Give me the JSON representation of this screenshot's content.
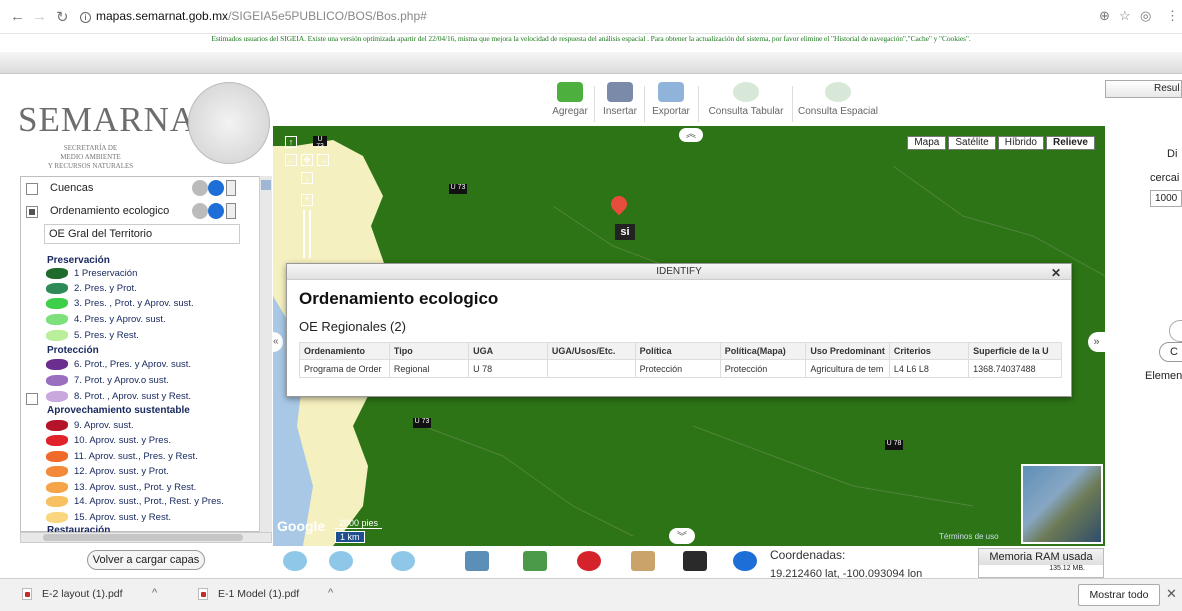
{
  "browser": {
    "url_host": "mapas.semarnat.gob.mx",
    "url_path": "/SIGEIA5e5PUBLICO/BOS/Bos.php#",
    "notice": "Estimados usuarios del SIGEIA. Existe una versión optimizada apartir del 22/04/16, misma que mejora la velocidad de respuesta del análisis espacial . Para obtener la actualización del sistema, por favor elimine el \"Historial de navegación\",\"Cache\" y \"Cookies\"."
  },
  "logo": {
    "name": "SEMARNAT",
    "subtitle_1": "SECRETARÍA DE",
    "subtitle_2": "MEDIO AMBIENTE",
    "subtitle_3": "Y RECURSOS NATURALES"
  },
  "toolbar": {
    "agregar": "Agregar",
    "insertar": "Insertar",
    "exportar": "Exportar",
    "consulta_tabular": "Consulta Tabular",
    "consulta_espacial": "Consulta Espacial"
  },
  "right_panel": {
    "tab": "Resul",
    "line1": "Di",
    "line2": "cercai",
    "input_value": "1000",
    "button": "C",
    "label": "Element"
  },
  "layers": {
    "items": [
      {
        "label": "Cuencas",
        "checked": false
      },
      {
        "label": "Ordenamiento ecologico",
        "checked": true
      }
    ],
    "sub_select": "OE Gral del Territorio",
    "legend": {
      "preservacion": "Preservación",
      "proteccion": "Protección",
      "aprovechamiento": "Aprovechamiento sustentable",
      "restauracion": "Restauración",
      "entries": [
        {
          "label": "1 Preservación",
          "color": "#1e6b2c"
        },
        {
          "label": "2. Pres. y Prot.",
          "color": "#2e8b57"
        },
        {
          "label": "3. Pres. , Prot. y Aprov. sust.",
          "color": "#3ecf4a"
        },
        {
          "label": "4. Pres. y Aprov. sust.",
          "color": "#7ee07a"
        },
        {
          "label": "5. Pres. y Rest.",
          "color": "#b9ee9a"
        },
        {
          "label": "6. Prot., Pres. y Aprov. sust.",
          "color": "#6b2d8f"
        },
        {
          "label": "7. Prot. y Aprov.o sust.",
          "color": "#9a6fbf"
        },
        {
          "label": "8. Prot. , Aprov. sust y Rest.",
          "color": "#c8a8df"
        },
        {
          "label": "9.  Aprov. sust.",
          "color": "#b5132a"
        },
        {
          "label": "10. Aprov. sust. y Pres.",
          "color": "#e0232b"
        },
        {
          "label": "11. Aprov. sust., Pres. y Rest.",
          "color": "#f06a2a"
        },
        {
          "label": "12. Aprov. sust. y Prot.",
          "color": "#f28a3a"
        },
        {
          "label": "13. Aprov. sust., Prot. y Rest.",
          "color": "#f5a44a"
        },
        {
          "label": "14. Aprov. sust., Prot., Rest. y Pres.",
          "color": "#f8c060"
        },
        {
          "label": "15. Aprov. sust. y Rest.",
          "color": "#fad77e"
        }
      ]
    },
    "reload_button": "Volver a cargar capas"
  },
  "map": {
    "types": [
      "Mapa",
      "Satélite",
      "Híbrido",
      "Relieve"
    ],
    "active_type": "Relieve",
    "marker_label": "si",
    "road_labels": [
      "U 73",
      "U 73",
      "U 73",
      "U 78"
    ],
    "scale_top": "2000 pies",
    "scale_bottom": "1 km",
    "terms": "Términos de uso",
    "google": "Google"
  },
  "identify": {
    "header": "IDENTIFY",
    "title": "Ordenamiento ecologico",
    "subtitle": "OE Regionales (2)",
    "columns": [
      "Ordenamiento",
      "Tipo",
      "UGA",
      "UGA/Usos/Etc.",
      "Política",
      "Política(Mapa)",
      "Uso Predominant",
      "Criterios",
      "Superficie de la U"
    ],
    "rows": [
      [
        "Programa de Order",
        "Regional",
        "U 78",
        "",
        "Protección",
        "Protección",
        "Agricultura de tem",
        "L4  L6  L8",
        "1368.74037488"
      ]
    ]
  },
  "status": {
    "coords_label": "Coordenadas:",
    "coords_value": "19.212460 lat, -100.093094 lon",
    "ram_label": "Memoria RAM usada",
    "ram_value": "135.12 MB."
  },
  "downloads": {
    "items": [
      "E-2 layout (1).pdf",
      "E-1 Model (1).pdf"
    ],
    "show_all": "Mostrar todo"
  }
}
